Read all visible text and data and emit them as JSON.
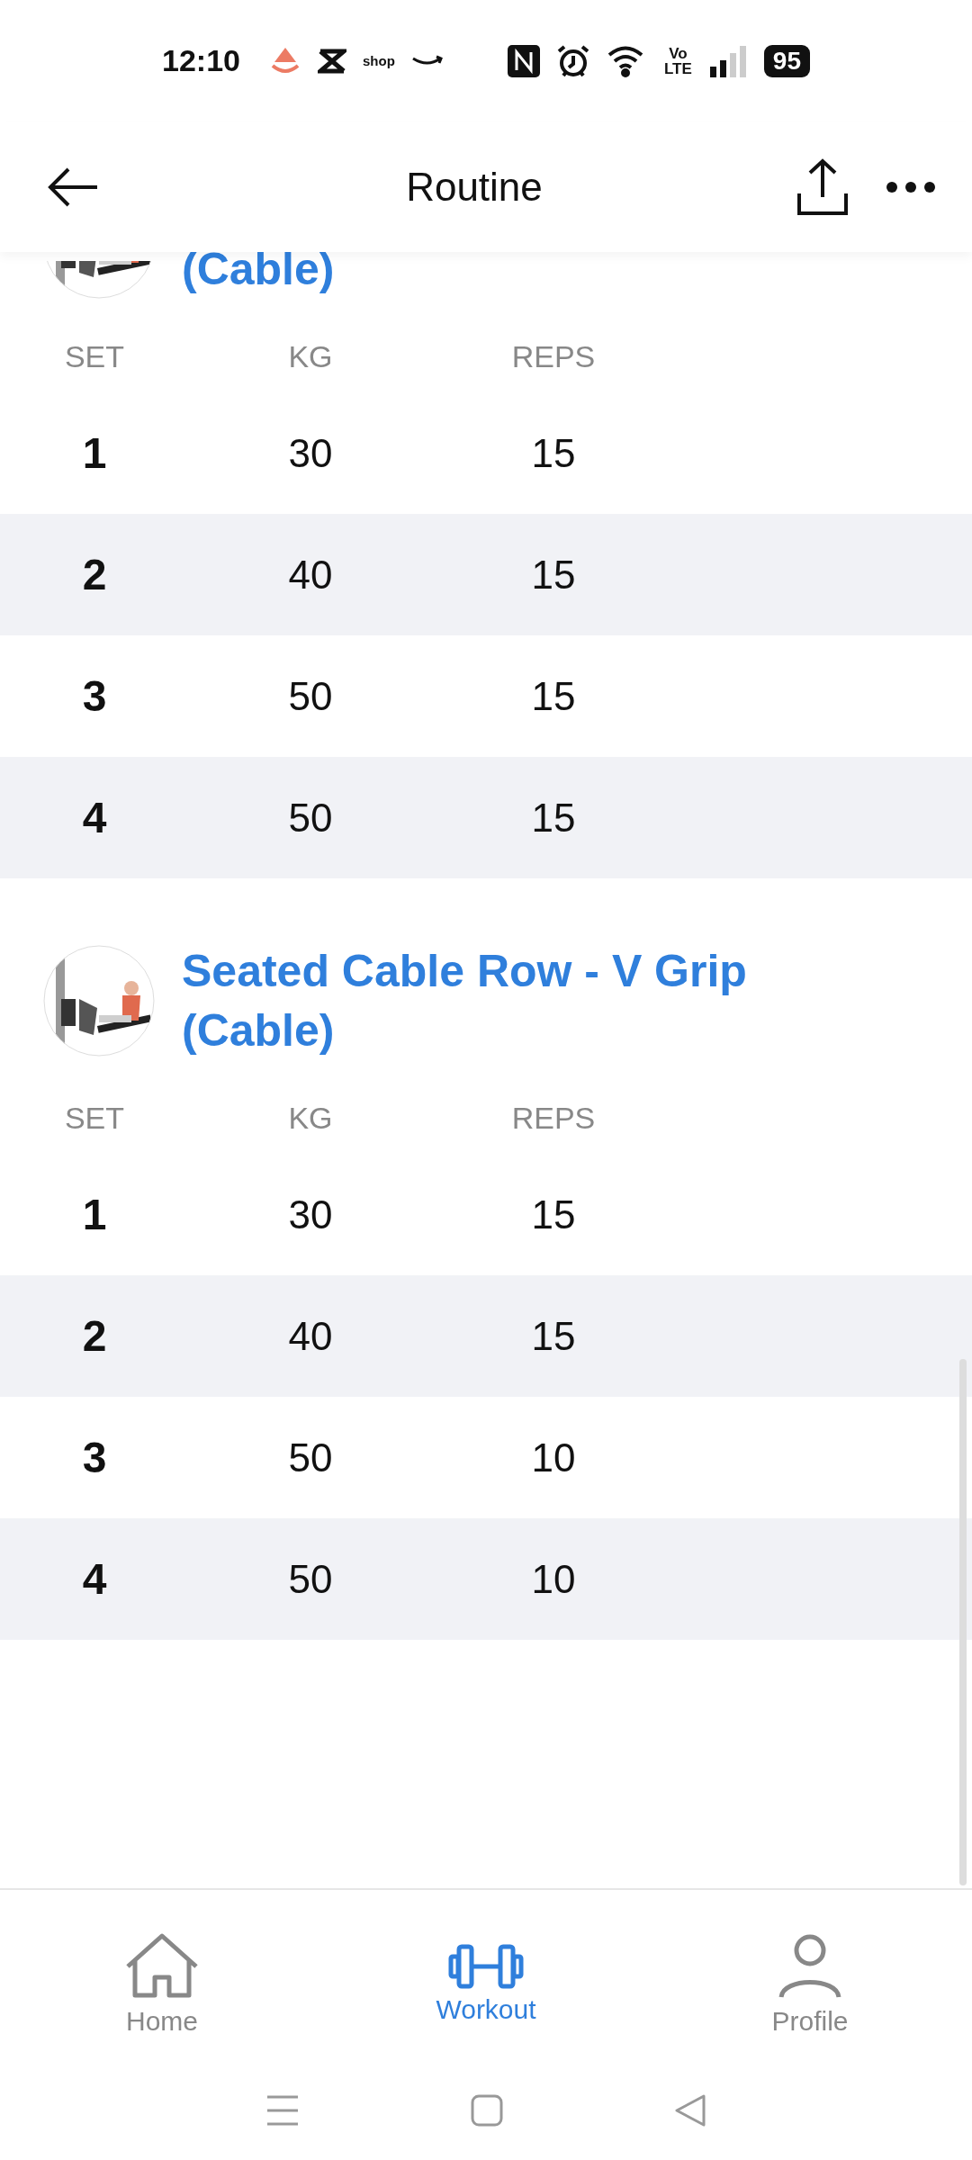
{
  "status_bar": {
    "time": "12:10",
    "shop_label": "shop",
    "volte": [
      "Vo",
      "LTE"
    ],
    "battery": "95"
  },
  "header": {
    "title": "Routine"
  },
  "exercises": [
    {
      "title": "(Cable)",
      "clipped": true,
      "columns": [
        "SET",
        "KG",
        "REPS"
      ],
      "sets": [
        {
          "set": "1",
          "kg": "30",
          "reps": "15"
        },
        {
          "set": "2",
          "kg": "40",
          "reps": "15"
        },
        {
          "set": "3",
          "kg": "50",
          "reps": "15"
        },
        {
          "set": "4",
          "kg": "50",
          "reps": "15"
        }
      ]
    },
    {
      "title": "Seated Cable Row - V Grip (Cable)",
      "clipped": false,
      "columns": [
        "SET",
        "KG",
        "REPS"
      ],
      "sets": [
        {
          "set": "1",
          "kg": "30",
          "reps": "15"
        },
        {
          "set": "2",
          "kg": "40",
          "reps": "15"
        },
        {
          "set": "3",
          "kg": "50",
          "reps": "10"
        },
        {
          "set": "4",
          "kg": "50",
          "reps": "10"
        }
      ]
    }
  ],
  "bottom_nav": [
    {
      "kind": "home",
      "label": "Home",
      "selected": false
    },
    {
      "kind": "workout",
      "label": "Workout",
      "selected": true
    },
    {
      "kind": "profile",
      "label": "Profile",
      "selected": false
    }
  ]
}
